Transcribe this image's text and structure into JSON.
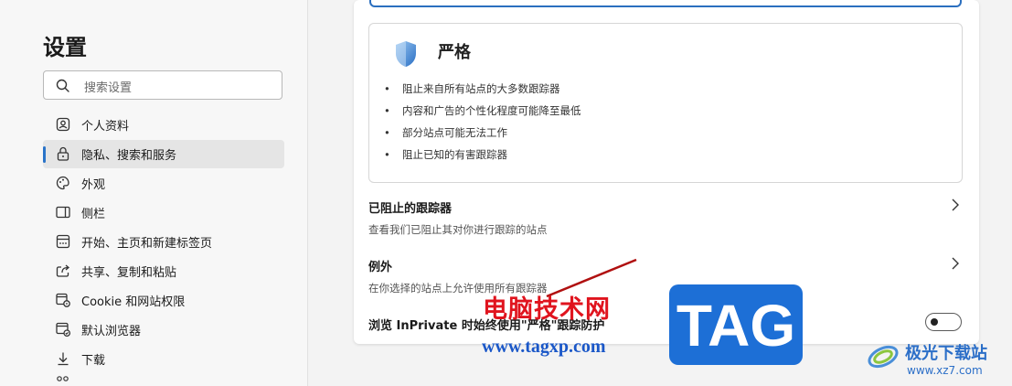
{
  "sidebar": {
    "title": "设置",
    "search_placeholder": "搜索设置",
    "items": [
      {
        "label": "个人资料",
        "icon": "profile-icon"
      },
      {
        "label": "隐私、搜索和服务",
        "icon": "lock-icon",
        "active": true
      },
      {
        "label": "外观",
        "icon": "palette-icon"
      },
      {
        "label": "侧栏",
        "icon": "sidebar-icon"
      },
      {
        "label": "开始、主页和新建标签页",
        "icon": "home-tabs-icon"
      },
      {
        "label": "共享、复制和粘贴",
        "icon": "share-icon"
      },
      {
        "label": "Cookie 和网站权限",
        "icon": "cookie-icon"
      },
      {
        "label": "默认浏览器",
        "icon": "browser-icon"
      },
      {
        "label": "下载",
        "icon": "download-icon"
      }
    ]
  },
  "main": {
    "strict": {
      "title": "严格",
      "bullets": [
        "阻止来自所有站点的大多数跟踪器",
        "内容和广告的个性化程度可能降至最低",
        "部分站点可能无法工作",
        "阻止已知的有害跟踪器"
      ]
    },
    "blocked_trackers": {
      "title": "已阻止的跟踪器",
      "subtitle": "查看我们已阻止其对你进行跟踪的站点"
    },
    "exceptions": {
      "title": "例外",
      "subtitle": "在你选择的站点上允许使用所有跟踪器"
    },
    "inprivate": {
      "title": "浏览 InPrivate 时始终使用\"严格\"跟踪防护",
      "toggle_on": false
    }
  },
  "watermark": {
    "cn_text": "电脑技术网",
    "url": "www.tagxp.com",
    "badge": "TAG",
    "corner_name": "极光下载站",
    "corner_url": "www.xz7.com"
  },
  "colors": {
    "accent": "#2a74c9",
    "watermark_red": "#e0141e",
    "tag_blue": "#1d6fd6"
  }
}
